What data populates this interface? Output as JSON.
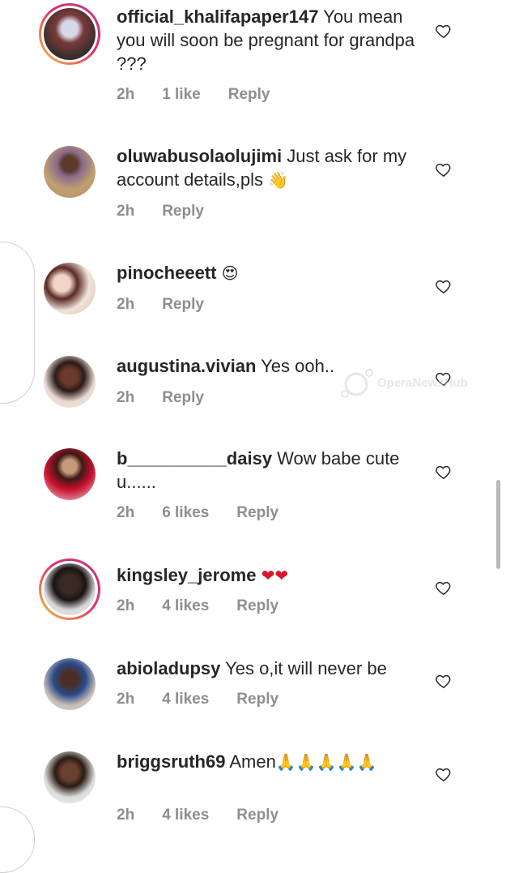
{
  "colors": {
    "text": "#262626",
    "meta": "#8e8e8e",
    "heart_outline": "#262626",
    "story_ring_start": "#f9c23c",
    "story_ring_end": "#c13584"
  },
  "watermark": {
    "text": "OperaNewsHub"
  },
  "comments": [
    {
      "username": "official_khalifapaper147",
      "text": " You mean you will soon be  pregnant for  grandpa ???",
      "emoji": "",
      "time": "2h",
      "likes": "1 like",
      "reply": "Reply",
      "story_ring": true
    },
    {
      "username": "oluwabusolaolujimi",
      "text": " Just ask for my account details,pls ",
      "emoji": "👋",
      "time": "2h",
      "likes": "",
      "reply": "Reply",
      "story_ring": false
    },
    {
      "username": "pinocheeett",
      "text": " ",
      "emoji": "😍",
      "time": "2h",
      "likes": "",
      "reply": "Reply",
      "story_ring": false
    },
    {
      "username": "augustina.vivian",
      "text": " Yes ooh..",
      "emoji": "",
      "time": "2h",
      "likes": "",
      "reply": "Reply",
      "story_ring": false
    },
    {
      "username": "b__________daisy",
      "text": " Wow babe cute u......",
      "emoji": "",
      "time": "2h",
      "likes": "6 likes",
      "reply": "Reply",
      "story_ring": false
    },
    {
      "username": "kingsley_jerome",
      "text": " ",
      "emoji": "❤❤",
      "time": "2h",
      "likes": "4 likes",
      "reply": "Reply",
      "story_ring": true
    },
    {
      "username": "abioladupsy",
      "text": " Yes o,it will never be",
      "emoji": "",
      "time": "2h",
      "likes": "4 likes",
      "reply": "Reply",
      "story_ring": false
    },
    {
      "username": "briggsruth69",
      "text": " Amen",
      "emoji": "🙏🙏🙏🙏🙏",
      "time": "2h",
      "likes": "4 likes",
      "reply": "Reply",
      "story_ring": false
    }
  ]
}
